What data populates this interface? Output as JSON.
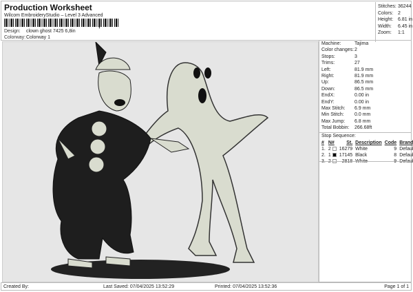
{
  "header": {
    "title": "Production Worksheet",
    "subtitle": "Wilcom EmbroideryStudio – Level 3 Advanced",
    "design_label": "Design:",
    "design_value": "clown ghost 7425 6,8in",
    "colorway_label": "Colorway:",
    "colorway_value": "Colorway 1"
  },
  "stats": [
    {
      "label": "Stitches:",
      "value": "36244"
    },
    {
      "label": "Colors:",
      "value": "2"
    },
    {
      "label": "Height:",
      "value": "6.81 in"
    },
    {
      "label": "Width:",
      "value": "6.45 in"
    },
    {
      "label": "Zoom:",
      "value": "1:1"
    }
  ],
  "info": [
    {
      "label": "Machine:",
      "value": "Tajima"
    },
    {
      "label": "Color changes:",
      "value": "2"
    },
    {
      "label": "Stops:",
      "value": "3"
    },
    {
      "label": "Trims:",
      "value": "27"
    },
    {
      "label": "Left:",
      "value": "81.9 mm"
    },
    {
      "label": "Right:",
      "value": "81.9 mm"
    },
    {
      "label": "Up:",
      "value": "86.5 mm"
    },
    {
      "label": "Down:",
      "value": "86.5 mm"
    },
    {
      "label": "EndX:",
      "value": "0.00 in"
    },
    {
      "label": "EndY:",
      "value": "0.00 in"
    },
    {
      "label": "Max Stitch:",
      "value": "6.9 mm"
    },
    {
      "label": "Min Stitch:",
      "value": "0.0 mm"
    },
    {
      "label": "Max Jump:",
      "value": "6.8 mm"
    },
    {
      "label": "Total Bobbin:",
      "value": "266.68ft"
    }
  ],
  "stop_sequence": {
    "title": "Stop Sequence:",
    "headers": [
      "#",
      "N#",
      "St.",
      "Description",
      "Code",
      "Brand"
    ],
    "rows": [
      {
        "n": "1.",
        "needle": "2",
        "color": "#ffffff",
        "st": "16279",
        "desc": "White",
        "code": "9",
        "brand": "Default"
      },
      {
        "n": "2.",
        "needle": "1",
        "color": "#000000",
        "st": "17145",
        "desc": "Black",
        "code": "8",
        "brand": "Default"
      },
      {
        "n": "3.",
        "needle": "2",
        "color": "#ffffff",
        "st": "2818",
        "desc": "White",
        "code": "9",
        "brand": "Default"
      }
    ]
  },
  "footer": {
    "created": "Created By:",
    "saved": "Last Saved: 07/04/2025 13:52:29",
    "printed": "Printed: 07/04/2025 13:52:36",
    "page": "Page 1 of 1"
  }
}
